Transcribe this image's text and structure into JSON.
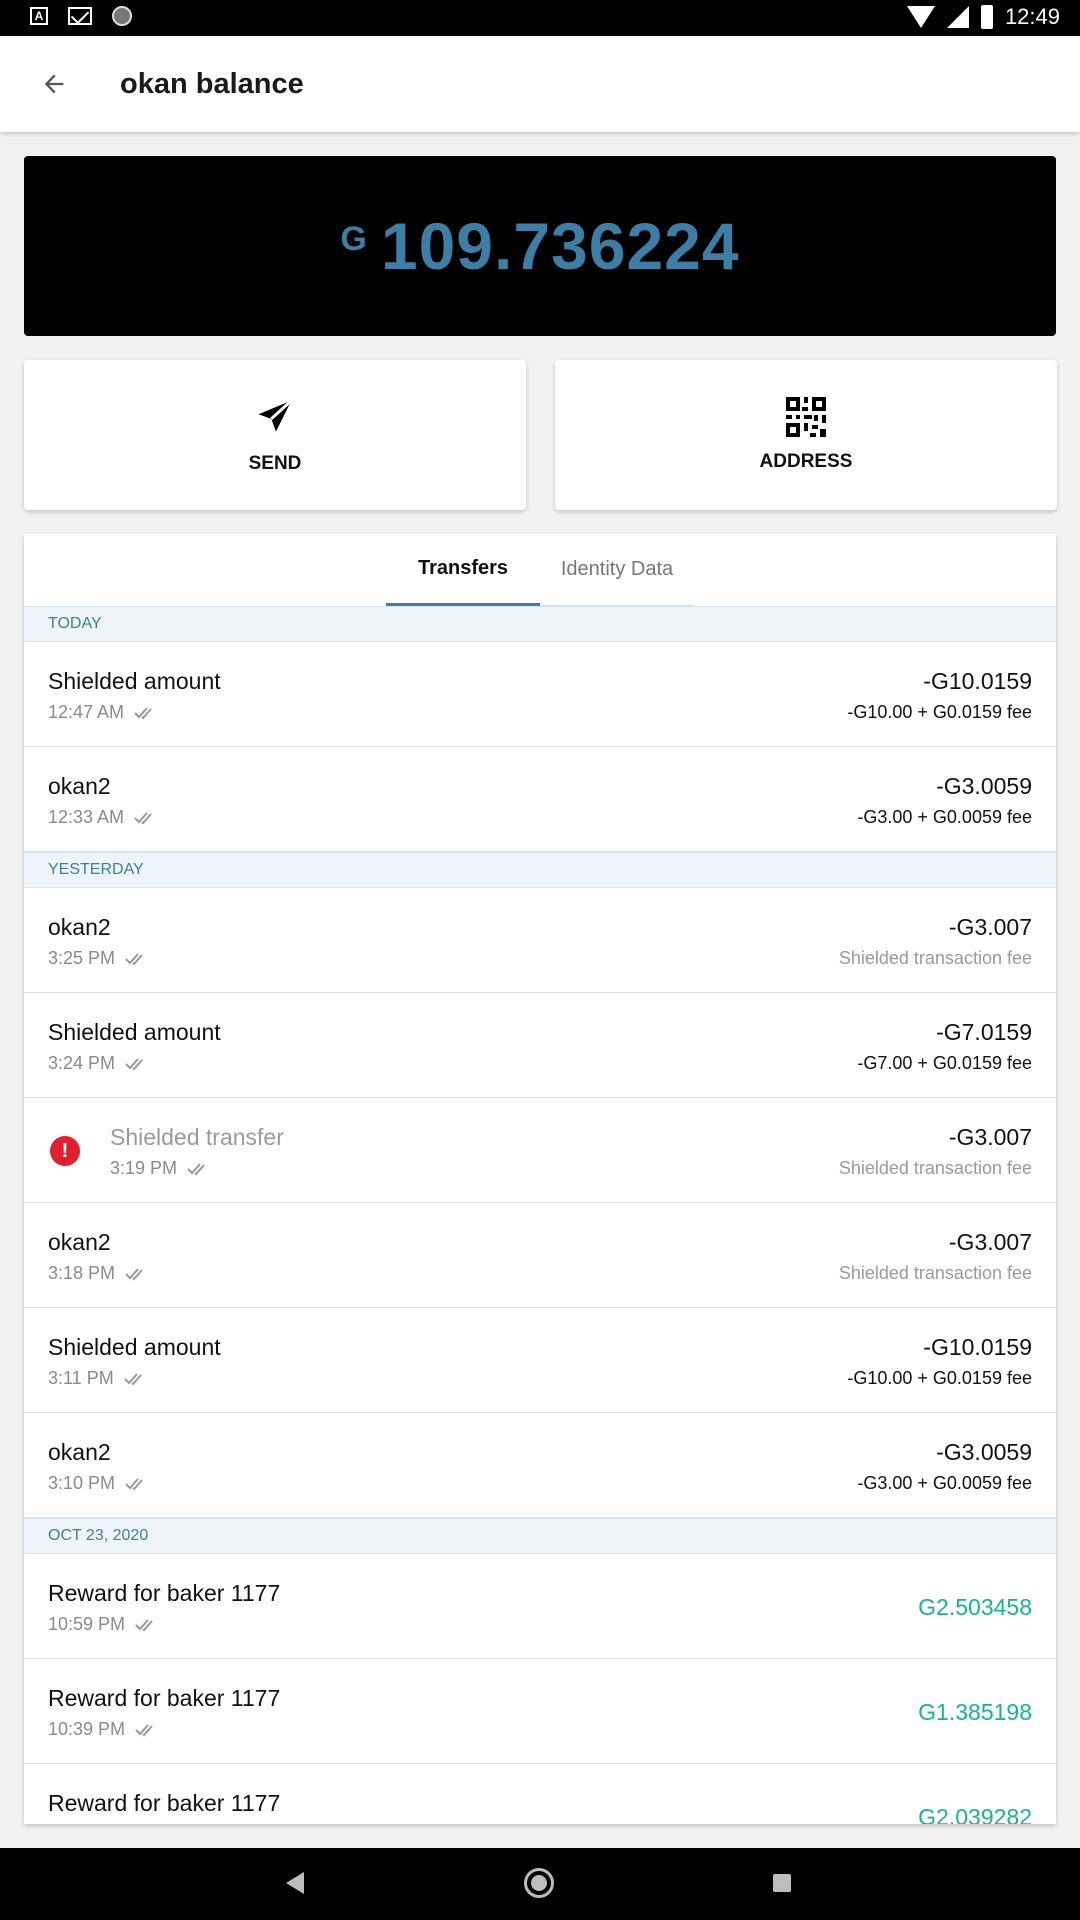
{
  "status_bar": {
    "time": "12:49"
  },
  "app_bar": {
    "title": "okan balance"
  },
  "balance": {
    "symbol": "G",
    "amount": "109.736224"
  },
  "actions": {
    "send_label": "SEND",
    "address_label": "ADDRESS"
  },
  "tabs": {
    "transfers": "Transfers",
    "identity_data": "Identity Data"
  },
  "sections": {
    "today": "TODAY",
    "yesterday": "YESTERDAY",
    "oct23": "OCT 23, 2020"
  },
  "transactions": {
    "t0": {
      "name": "Shielded amount",
      "time": "12:47 AM",
      "amount": "-G10.0159",
      "detail": "-G10.00 + G0.0159 fee"
    },
    "t1": {
      "name": "okan2",
      "time": "12:33 AM",
      "amount": "-G3.0059",
      "detail": "-G3.00 + G0.0059 fee"
    },
    "y0": {
      "name": "okan2",
      "time": "3:25 PM",
      "amount": "-G3.007",
      "detail": "Shielded transaction fee"
    },
    "y1": {
      "name": "Shielded amount",
      "time": "3:24 PM",
      "amount": "-G7.0159",
      "detail": "-G7.00 + G0.0159 fee"
    },
    "y2": {
      "name": "Shielded transfer",
      "time": "3:19 PM",
      "amount": "-G3.007",
      "detail": "Shielded transaction fee"
    },
    "y3": {
      "name": "okan2",
      "time": "3:18 PM",
      "amount": "-G3.007",
      "detail": "Shielded transaction fee"
    },
    "y4": {
      "name": "Shielded amount",
      "time": "3:11 PM",
      "amount": "-G10.0159",
      "detail": "-G10.00 + G0.0159 fee"
    },
    "y5": {
      "name": "okan2",
      "time": "3:10 PM",
      "amount": "-G3.0059",
      "detail": "-G3.00 + G0.0059 fee"
    },
    "o0": {
      "name": "Reward for baker 1177",
      "time": "10:59 PM",
      "amount": "G2.503458"
    },
    "o1": {
      "name": "Reward for baker 1177",
      "time": "10:39 PM",
      "amount": "G1.385198"
    },
    "o2": {
      "name": "Reward for baker 1177",
      "amount": "G2.039282"
    }
  },
  "colors": {
    "accent": "#3d7ea6",
    "positive": "#16b58f",
    "error": "#e0202e"
  }
}
